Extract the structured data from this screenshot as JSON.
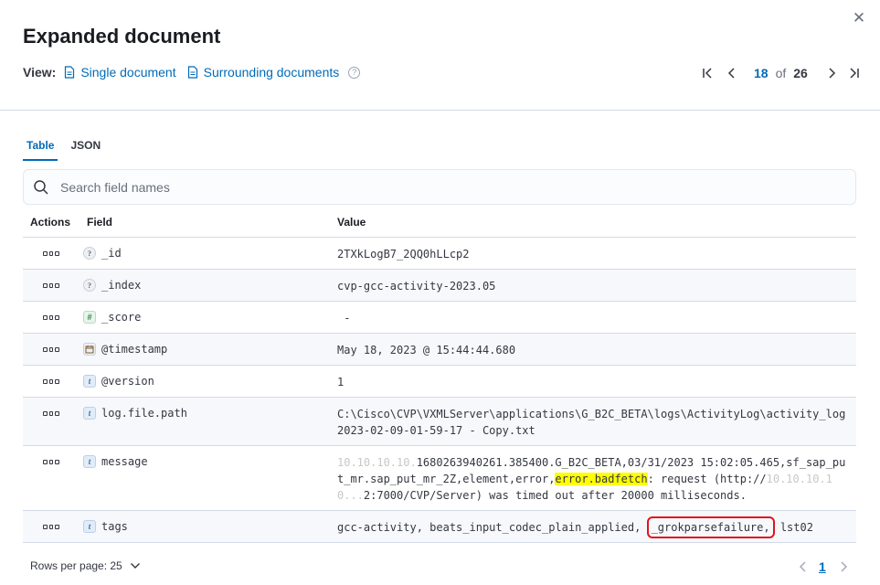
{
  "header": {
    "title": "Expanded document",
    "close_icon": "close-icon"
  },
  "view": {
    "label": "View:",
    "single_document": "Single document",
    "surrounding_documents": "Surrounding documents",
    "help_glyph": "?"
  },
  "pagination": {
    "current": "18",
    "of_label": "of",
    "total": "26"
  },
  "tabs": [
    {
      "label": "Table",
      "active": true
    },
    {
      "label": "JSON",
      "active": false
    }
  ],
  "search": {
    "placeholder": "Search field names"
  },
  "table": {
    "headers": {
      "actions": "Actions",
      "field": "Field",
      "value": "Value"
    },
    "rows": [
      {
        "type_glyph": "?",
        "field": "_id",
        "value": "2TXkLogB7_2QQ0hLLcp2"
      },
      {
        "type_glyph": "?",
        "field": "_index",
        "value": "cvp-gcc-activity-2023.05"
      },
      {
        "type_glyph": "#",
        "field": "_score",
        "value": " -"
      },
      {
        "type_glyph": "date",
        "field": "@timestamp",
        "value": "May 18, 2023 @ 15:44:44.680"
      },
      {
        "type_glyph": "t",
        "field": "@version",
        "value": "1"
      },
      {
        "type_glyph": "t",
        "field": "log.file.path",
        "value": "C:\\Cisco\\CVP\\VXMLServer\\applications\\G_B2C_BETA\\logs\\ActivityLog\\activity_log2023-02-09-01-59-17 - Copy.txt"
      },
      {
        "type_glyph": "t",
        "field": "message",
        "value_blur1": "10.10.10.10.",
        "value_a": "1680263940261.385400.G_B2C_BETA,03/31/2023 15:02:05.465,sf_sap_put_mr.sap_put_mr_2Z,element,error,",
        "value_mark": "error.badfetch",
        "value_b": ": request (http://",
        "value_blur2": "10.10.10.10...",
        "value_c": "2:7000/CVP/Server) was timed out after 20000 milliseconds."
      },
      {
        "type_glyph": "t",
        "field": "tags",
        "value_a": "gcc-activity, beats_input_codec_plain_applied, ",
        "value_box": "_grokparsefailure,",
        "value_b": " lst02"
      }
    ]
  },
  "footer": {
    "rows_per_page": "Rows per page: 25",
    "page": "1"
  }
}
